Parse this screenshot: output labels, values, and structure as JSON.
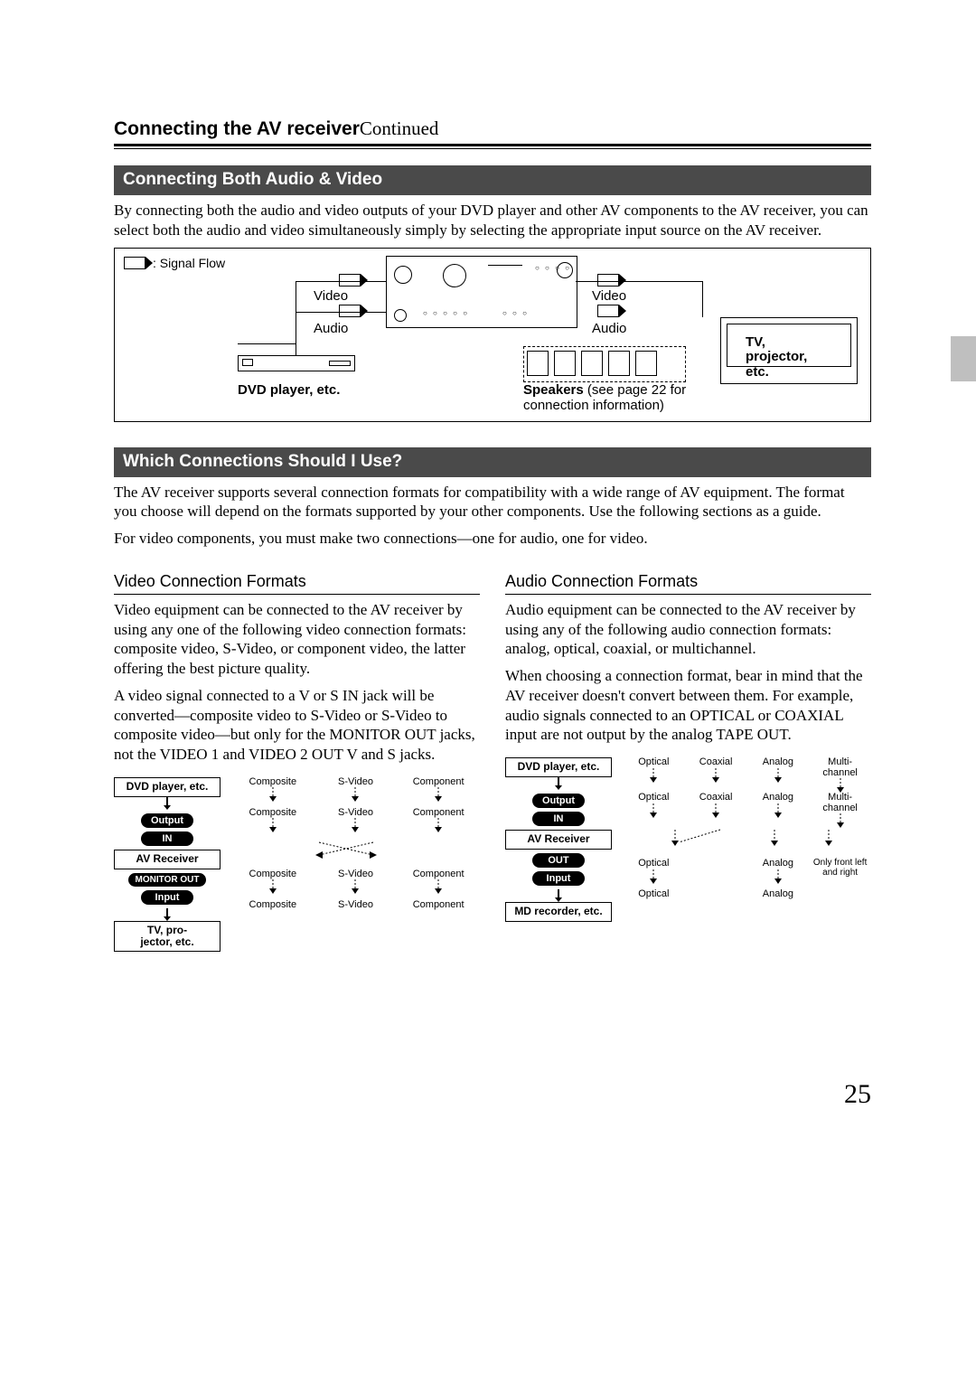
{
  "title": {
    "main": "Connecting the AV receiver",
    "cont": "Continued"
  },
  "sec1": {
    "header": "Connecting Both Audio & Video",
    "para": "By connecting both the audio and video outputs of your DVD player and other AV components to the AV receiver, you can select both the audio and video simultaneously simply by selecting the appropriate input source on the AV receiver.",
    "legend": ": Signal Flow",
    "labels": {
      "video_l": "Video",
      "audio_l": "Audio",
      "video_r": "Video",
      "audio_r": "Audio",
      "dvd": "DVD player, etc.",
      "tv": "TV, projector, etc.",
      "speakers_b": "Speakers",
      "speakers_rest": " (see page 22 for connection information)"
    }
  },
  "sec2": {
    "header": "Which Connections Should I Use?",
    "para1": "The AV receiver supports several connection formats for compatibility with a wide range of AV equipment. The format you choose will depend on the formats supported by your other components. Use the following sections as a guide.",
    "para2": "For video components, you must make two connections—one for audio, one for video."
  },
  "video_formats": {
    "header": "Video Connection Formats",
    "p1": "Video equipment can be connected to the AV receiver by using any one of the following video connection formats: composite video, S-Video, or component video, the latter offering the best picture quality.",
    "p2": "A video signal connected to a V or S IN jack will be converted—composite video to S-Video or S-Video to composite video—but only for the MONITOR OUT jacks, not the VIDEO 1 and VIDEO 2 OUT V and S jacks.",
    "chain": {
      "dvd": "DVD player, etc.",
      "output": "Output",
      "in": "IN",
      "receiver": "AV Receiver",
      "monitor_out": "MONITOR OUT",
      "input": "Input",
      "tv": "TV, pro-\njector, etc."
    },
    "cols": [
      "Composite",
      "S-Video",
      "Component"
    ]
  },
  "audio_formats": {
    "header": "Audio Connection Formats",
    "p1": "Audio equipment can be connected to the AV receiver by using any of the following audio connection formats: analog, optical, coaxial, or multichannel.",
    "p2": "When choosing a connection format, bear in mind that the AV receiver doesn't convert between them. For example, audio signals connected to an OPTICAL or COAXIAL input are not output by the analog TAPE OUT.",
    "chain": {
      "dvd": "DVD player, etc.",
      "output": "Output",
      "in": "IN",
      "receiver": "AV Receiver",
      "out": "OUT",
      "input": "Input",
      "md": "MD recorder, etc."
    },
    "cols_top": [
      "Optical",
      "Coaxial",
      "Analog",
      "Multi-\nchannel"
    ],
    "cols_mid": [
      "Optical",
      "Coaxial",
      "Analog",
      "Multi-\nchannel"
    ],
    "cols_out": [
      "Optical",
      "",
      "Analog",
      "Only front left and right"
    ],
    "cols_bot": [
      "Optical",
      "",
      "Analog",
      ""
    ]
  },
  "page_number": "25"
}
